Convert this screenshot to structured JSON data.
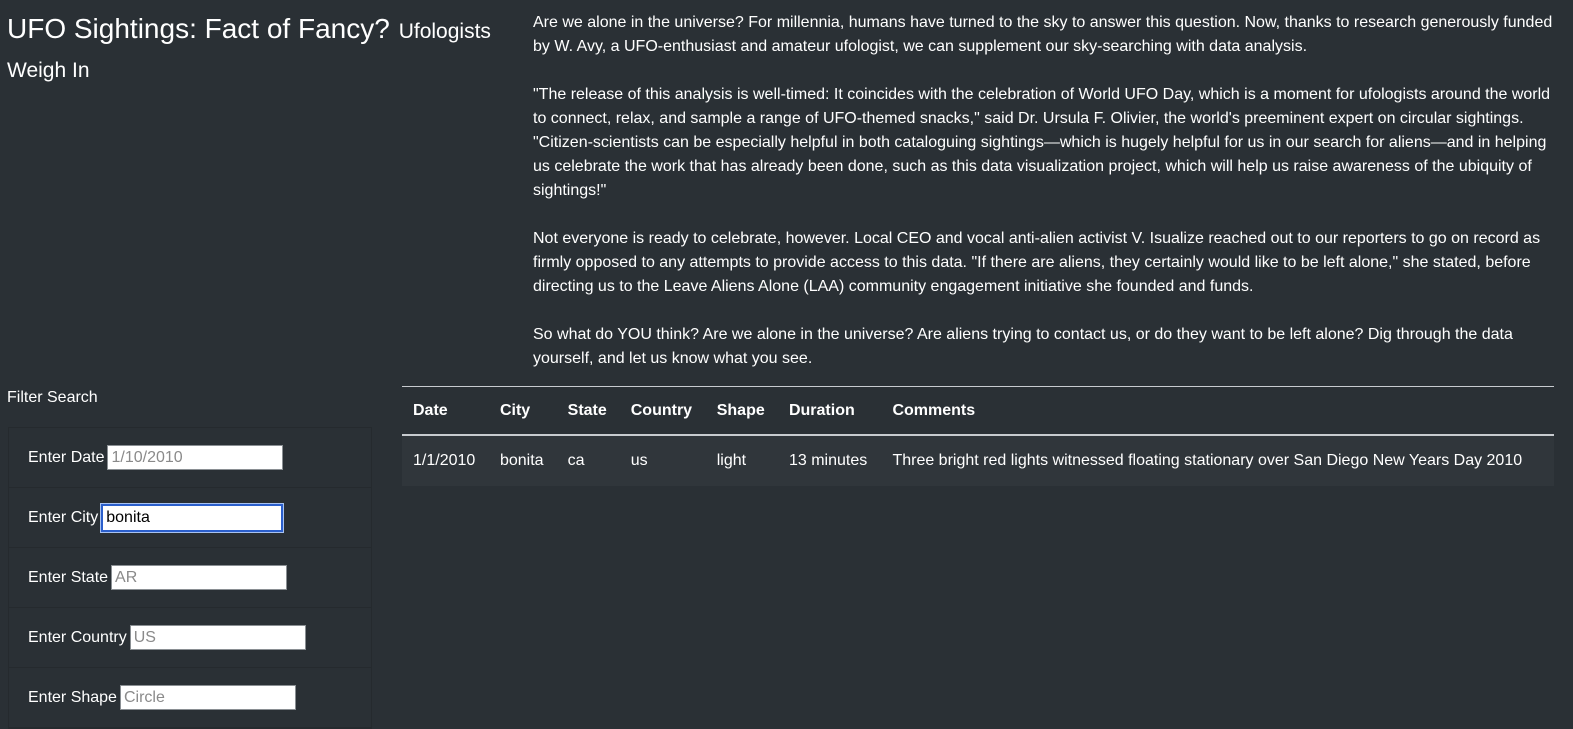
{
  "header": {
    "title": "UFO Sightings: Fact of Fancy?",
    "subtitle": "Ufologists Weigh In"
  },
  "intro": {
    "paragraphs": [
      "Are we alone in the universe? For millennia, humans have turned to the sky to answer this question. Now, thanks to research generously funded by W. Avy, a UFO-enthusiast and amateur ufologist, we can supplement our sky-searching with data analysis.",
      "\"The release of this analysis is well-timed: It coincides with the celebration of World UFO Day, which is a moment for ufologists around the world to connect, relax, and sample a range of UFO-themed snacks,\" said Dr. Ursula F. Olivier, the world's preeminent expert on circular sightings. \"Citizen-scientists can be especially helpful in both cataloguing sightings—which is hugely helpful for us in our search for aliens—and in helping us celebrate the work that has already been done, such as this data visualization project, which will help us raise awareness of the ubiquity of sightings!\"",
      "Not everyone is ready to celebrate, however. Local CEO and vocal anti-alien activist V. Isualize reached out to our reporters to go on record as firmly opposed to any attempts to provide access to this data. \"If there are aliens, they certainly would like to be left alone,\" she stated, before directing us to the Leave Aliens Alone (LAA) community engagement initiative she founded and funds.",
      "So what do YOU think? Are we alone in the universe? Are aliens trying to contact us, or do they want to be left alone? Dig through the data yourself, and let us know what you see."
    ]
  },
  "filters": {
    "heading": "Filter Search",
    "date": {
      "label": "Enter Date",
      "placeholder": "1/10/2010",
      "value": ""
    },
    "city": {
      "label": "Enter City",
      "placeholder": "",
      "value": "bonita"
    },
    "state": {
      "label": "Enter State",
      "placeholder": "AR",
      "value": ""
    },
    "country": {
      "label": "Enter Country",
      "placeholder": "US",
      "value": ""
    },
    "shape": {
      "label": "Enter Shape",
      "placeholder": "Circle",
      "value": ""
    }
  },
  "table": {
    "headers": [
      "Date",
      "City",
      "State",
      "Country",
      "Shape",
      "Duration",
      "Comments"
    ],
    "rows": [
      [
        "1/1/2010",
        "bonita",
        "ca",
        "us",
        "light",
        "13 minutes",
        "Three bright red lights witnessed floating stationary over San Diego New Years Day 2010"
      ]
    ]
  }
}
